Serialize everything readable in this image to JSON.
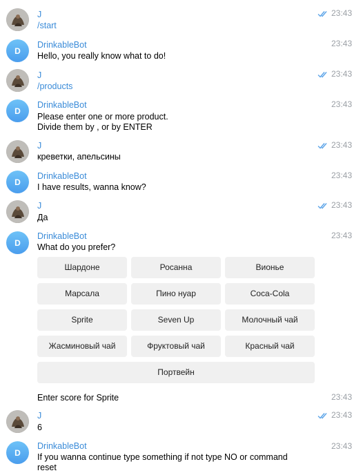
{
  "messages": [
    {
      "sender": "J",
      "text": "/start",
      "time": "23:43",
      "read": true
    },
    {
      "sender": "DrinkableBot",
      "text": "Hello, you really know what to do!",
      "time": "23:43"
    },
    {
      "sender": "J",
      "text": "/products",
      "time": "23:43",
      "read": true
    },
    {
      "sender": "DrinkableBot",
      "text": "Please enter one or more product.",
      "text2": "Divide them by , or by ENTER",
      "time": "23:43"
    },
    {
      "sender": "J",
      "text": "креветки, апельсины",
      "time": "23:43",
      "read": true
    },
    {
      "sender": "DrinkableBot",
      "text": "I have results, wanna know?",
      "time": "23:43"
    },
    {
      "sender": "J",
      "text": "Да",
      "time": "23:43",
      "read": true
    },
    {
      "sender": "DrinkableBot",
      "text": "What do you prefer?",
      "time": "23:43"
    },
    {
      "text": "Enter score for Sprite",
      "time": "23:43"
    },
    {
      "sender": "J",
      "text": "6",
      "time": "23:43",
      "read": true
    },
    {
      "sender": "DrinkableBot",
      "text": "If you wanna continue type something if not type NO or command",
      "text2": "reset",
      "time": "23:43"
    }
  ],
  "bot_avatar_letter": "D",
  "keyboard": {
    "buttons": [
      "Шардоне",
      "Росанна",
      "Вионье",
      "Марсала",
      "Пино нуар",
      "Coca-Cola",
      "Sprite",
      "Seven Up",
      "Молочный чай",
      "Жасминовый чай",
      "Фруктовый чай",
      "Красный чай",
      "Портвейн"
    ]
  },
  "colors": {
    "accent": "#3a8bd8",
    "read_check": "#5aa3e8",
    "time": "#9a9fa5",
    "button_bg": "#f0f0f0"
  },
  "icons": {
    "read_receipt": "double-check-icon",
    "user_avatar": "user-avatar-photo",
    "bot_avatar": "letter-avatar"
  }
}
